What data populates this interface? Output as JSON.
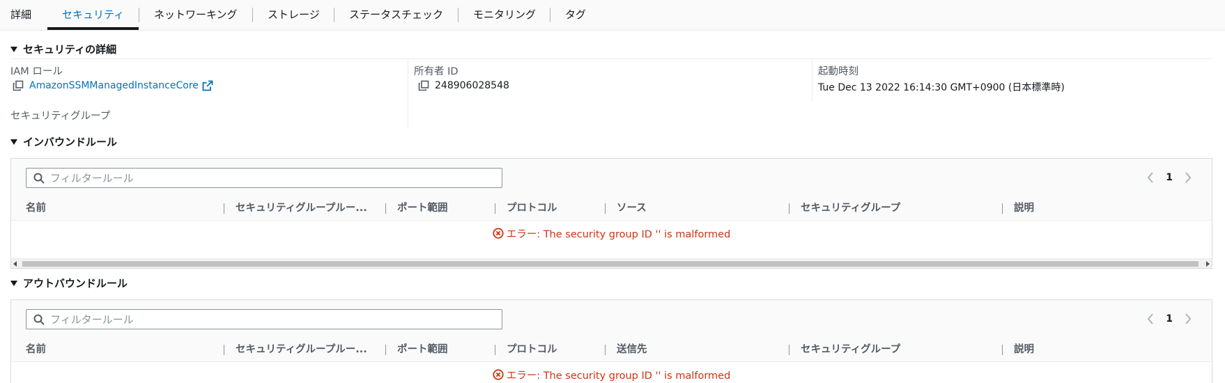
{
  "tabs": [
    "詳細",
    "セキュリティ",
    "ネットワーキング",
    "ストレージ",
    "ステータスチェック",
    "モニタリング",
    "タグ"
  ],
  "security_details": {
    "title": "セキュリティの詳細",
    "iam_role_label": "IAM ロール",
    "iam_role_value": "AmazonSSMManagedInstanceCore",
    "owner_id_label": "所有者 ID",
    "owner_id_value": "248906028548",
    "launch_time_label": "起動時刻",
    "launch_time_value": "Tue Dec 13 2022 16:14:30 GMT+0900 (日本標準時)",
    "security_groups_label": "セキュリティグループ"
  },
  "inbound": {
    "title": "インバウンドルール",
    "filter_placeholder": "フィルタールール",
    "page": "1",
    "columns": [
      "名前",
      "セキュリティグループルー...",
      "ポート範囲",
      "プロトコル",
      "ソース",
      "セキュリティグループ",
      "説明"
    ],
    "error": "エラー: The security group ID '' is malformed"
  },
  "outbound": {
    "title": "アウトバウンドルール",
    "filter_placeholder": "フィルタールール",
    "page": "1",
    "columns": [
      "名前",
      "セキュリティグループルー...",
      "ポート範囲",
      "プロトコル",
      "送信先",
      "セキュリティグループ",
      "説明"
    ],
    "error": "エラー: The security group ID '' is malformed"
  },
  "colors": {
    "accent": "#0073bb",
    "error": "#d13212",
    "text": "#16191f",
    "muted": "#545b64"
  },
  "icons": [
    "copy-icon",
    "external-link-icon",
    "search-icon",
    "chevron-left-icon",
    "chevron-right-icon",
    "error-icon",
    "caret-down-icon"
  ]
}
